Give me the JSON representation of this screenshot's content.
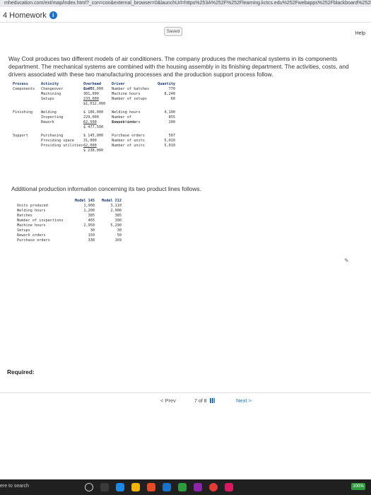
{
  "browser": {
    "url": "mheducation.com/ext/map/index.html?_con=con&external_browser=0&launchUrl=https%253A%252F%252Flearning.kctcs.edu%252Fwebapps%252Fblackboard%252Fexecute"
  },
  "header": {
    "title": "4 Homework",
    "info_symbol": "i"
  },
  "toolbar": {
    "saved_label": "Saved",
    "help_label": "Help"
  },
  "intro": "Way Cool produces two different models of air conditioners. The company produces the mechanical systems in its components department. The mechanical systems are combined with the housing assembly in its finishing department. The activities, costs, and drivers associated with these two manufacturing processes and the production support process follow.",
  "table1": {
    "headers": {
      "process": "Process",
      "activity": "Activity",
      "cost": "Overhead Cost",
      "driver": "Driver",
      "quantity": "Quantity"
    },
    "groups": [
      {
        "process": "Components",
        "rows": [
          {
            "activity": "Changeover",
            "cost": "$ 478,000",
            "driver": "Number of batches",
            "quantity": "770"
          },
          {
            "activity": "Machining",
            "cost": "301,000",
            "driver": "Machine hours",
            "quantity": "8,240"
          },
          {
            "activity": "Setups",
            "cost": "233,000",
            "driver": "Number of setups",
            "quantity": "60"
          }
        ],
        "total": "$1,012,000"
      },
      {
        "process": "Finishing",
        "rows": [
          {
            "activity": "Welding",
            "cost": "$ 186,000",
            "driver": "Welding hours",
            "quantity": "4,100"
          },
          {
            "activity": "Inspecting",
            "cost": "229,000",
            "driver": "Number of inspections",
            "quantity": "855"
          },
          {
            "activity": "Rework",
            "cost": "62,500",
            "driver": "Rework orders",
            "quantity": "200"
          }
        ],
        "total": "$ 477,500"
      },
      {
        "process": "Support",
        "rows": [
          {
            "activity": "Purchasing",
            "cost": "$ 145,000",
            "driver": "Purchase orders",
            "quantity": "507"
          },
          {
            "activity": "Providing space",
            "cost": "31,000",
            "driver": "Number of units",
            "quantity": "5,010"
          },
          {
            "activity": "Providing utilities",
            "cost": "62,000",
            "driver": "Number of units",
            "quantity": "5,010"
          }
        ],
        "total": "$ 238,000"
      }
    ]
  },
  "addl_text": "Additional production information concerning its two product lines follows.",
  "table2": {
    "headers": {
      "label": "",
      "m1": "Model 145",
      "m2": "Model 212"
    },
    "rows": [
      {
        "label": "Units produced",
        "m1": "1,900",
        "m2": "3,110"
      },
      {
        "label": "Welding hours",
        "m1": "1,200",
        "m2": "2,900"
      },
      {
        "label": "Batches",
        "m1": "385",
        "m2": "385"
      },
      {
        "label": "Number of inspections",
        "m1": "465",
        "m2": "390"
      },
      {
        "label": "Machine hours",
        "m1": "2,950",
        "m2": "5,290"
      },
      {
        "label": "Setups",
        "m1": "30",
        "m2": "30"
      },
      {
        "label": "Rework orders",
        "m1": "150",
        "m2": "50"
      },
      {
        "label": "Purchase orders",
        "m1": "338",
        "m2": "169"
      }
    ]
  },
  "required_label": "Required:",
  "nav": {
    "prev_label": "< Prev",
    "page_current": "7",
    "page_sep": "of",
    "page_total": "8",
    "next_label": "Next >"
  },
  "taskbar": {
    "search_text": "ere to search",
    "zoom_text": "100%"
  },
  "colors": {
    "accent": "#1a73c8",
    "taskbar": "#202020"
  }
}
